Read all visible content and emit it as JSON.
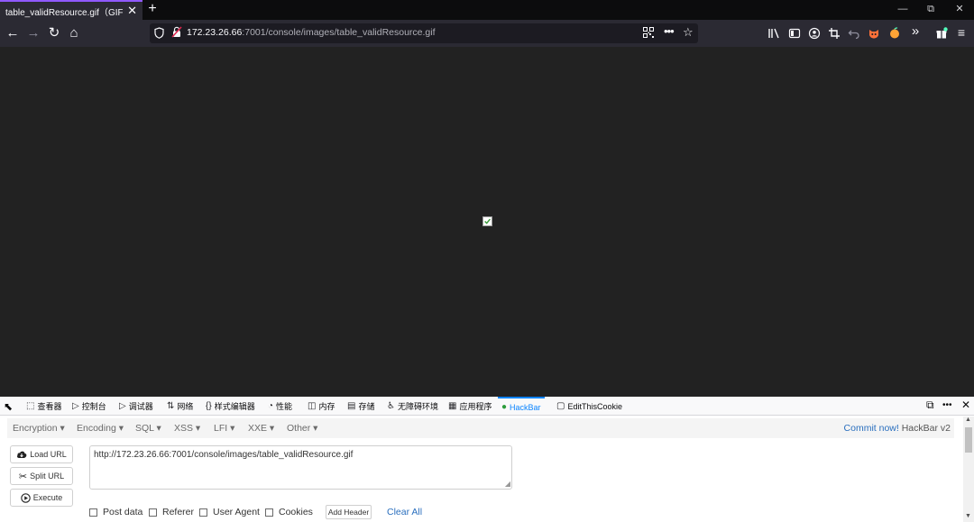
{
  "browser": {
    "tab": {
      "title": "table_validResource.gif（GIF 图像",
      "close": "✕"
    },
    "new_tab": "+",
    "window_controls": {
      "minimize": "—",
      "restore": "⧉",
      "close": "✕"
    },
    "url": {
      "host": "172.23.26.66",
      "path": ":7001/console/images/table_validResource.gif",
      "more": "•••",
      "star": "☆"
    },
    "nav": {
      "back": "←",
      "forward": "→",
      "reload": "↻",
      "home": "⌂"
    },
    "toolbar_icons": [
      "library-icon",
      "sidebar-icon",
      "account-icon",
      "screenshot-icon",
      "undo-icon",
      "extension-fox-icon",
      "extension-orange-icon",
      "overflow-icon",
      "extensions-icon",
      "menu-icon"
    ],
    "overflow": "»",
    "menu": "≡"
  },
  "devtools": {
    "tabs": [
      {
        "label": "查看器",
        "icon": "⬚"
      },
      {
        "label": "控制台",
        "icon": "▷"
      },
      {
        "label": "调试器",
        "icon": "▷"
      },
      {
        "label": "网络",
        "icon": "⇅"
      },
      {
        "label": "样式编辑器",
        "icon": "{}"
      },
      {
        "label": "性能",
        "icon": "◔"
      },
      {
        "label": "内存",
        "icon": "◫"
      },
      {
        "label": "存储",
        "icon": "▤"
      },
      {
        "label": "无障碍环境",
        "icon": "♿"
      },
      {
        "label": "应用程序",
        "icon": "▦"
      },
      {
        "label": "HackBar",
        "icon": "●"
      },
      {
        "label": "EditThisCookie",
        "icon": "▢"
      }
    ],
    "pick_icon": "⬉",
    "dock": "⧉",
    "more": "•••",
    "close": "✕"
  },
  "hackbar": {
    "menu": [
      "Encryption ▾",
      "Encoding ▾",
      "SQL ▾",
      "XSS ▾",
      "LFI ▾",
      "XXE ▾",
      "Other ▾"
    ],
    "commit_link": "Commit now!",
    "version": "HackBar v2",
    "buttons": {
      "load": "Load URL",
      "split": "Split URL",
      "execute": "Execute"
    },
    "url_value": "http://172.23.26.66:7001/console/images/table_validResource.gif",
    "checks": [
      "Post data",
      "Referer",
      "User Agent",
      "Cookies"
    ],
    "add_header": "Add Header",
    "clear_all": "Clear All"
  }
}
